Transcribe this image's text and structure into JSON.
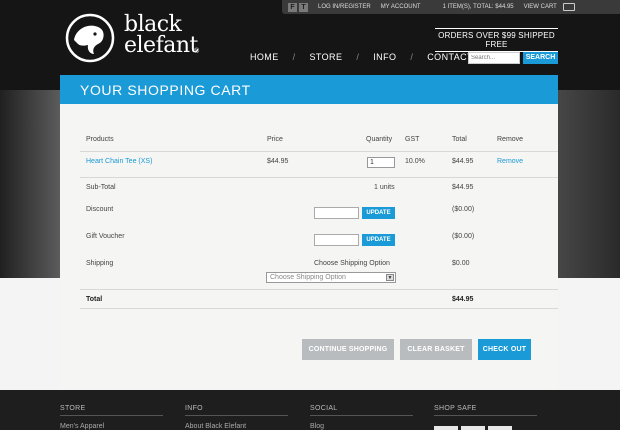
{
  "topbar": {
    "social": [
      "f",
      "t"
    ],
    "login": "LOG IN/REGISTER",
    "account": "MY ACCOUNT",
    "cart_summary": "1 ITEM(S), TOTAL: $44.95",
    "view_cart": "VIEW CART"
  },
  "logo": {
    "line1": "black",
    "line2": "elefant",
    "reg": "®"
  },
  "promo": "ORDERS OVER $99 SHIPPED FREE",
  "nav": [
    "HOME",
    "STORE",
    "INFO",
    "CONTACT"
  ],
  "search": {
    "placeholder": "Search...",
    "button": "SEARCH"
  },
  "cart": {
    "title": "YOUR SHOPPING CART",
    "headers": {
      "products": "Products",
      "price": "Price",
      "quantity": "Quantity",
      "gst": "GST",
      "total": "Total",
      "remove": "Remove"
    },
    "item": {
      "name": "Heart Chain Tee (XS)",
      "price": "$44.95",
      "qty": "1",
      "gst": "10.0%",
      "total": "$44.95",
      "remove": "Remove"
    },
    "subtotal": {
      "label": "Sub-Total",
      "units": "1 units",
      "value": "$44.95"
    },
    "discount": {
      "label": "Discount",
      "button": "UPDATE",
      "value": "($0.00)"
    },
    "voucher": {
      "label": "Gift Voucher",
      "button": "UPDATE",
      "value": "($0.00)"
    },
    "shipping": {
      "label": "Shipping",
      "choose": "Choose Shipping Option",
      "select": "Choose Shipping Option",
      "value": "$0.00"
    },
    "total": {
      "label": "Total",
      "value": "$44.95"
    },
    "buttons": {
      "continue": "CONTINUE SHOPPING",
      "clear": "CLEAR BASKET",
      "checkout": "CHECK OUT"
    }
  },
  "footer": {
    "cols": [
      {
        "title": "STORE",
        "link": "Men's Apparel"
      },
      {
        "title": "INFO",
        "link": "About Black Elefant"
      },
      {
        "title": "SOCIAL",
        "link": "Blog"
      },
      {
        "title": "SHOP SAFE",
        "link": ""
      }
    ]
  },
  "colors": {
    "accent": "#1a9ad6",
    "grey_button": "#b9bcbf",
    "header": "#151515"
  }
}
